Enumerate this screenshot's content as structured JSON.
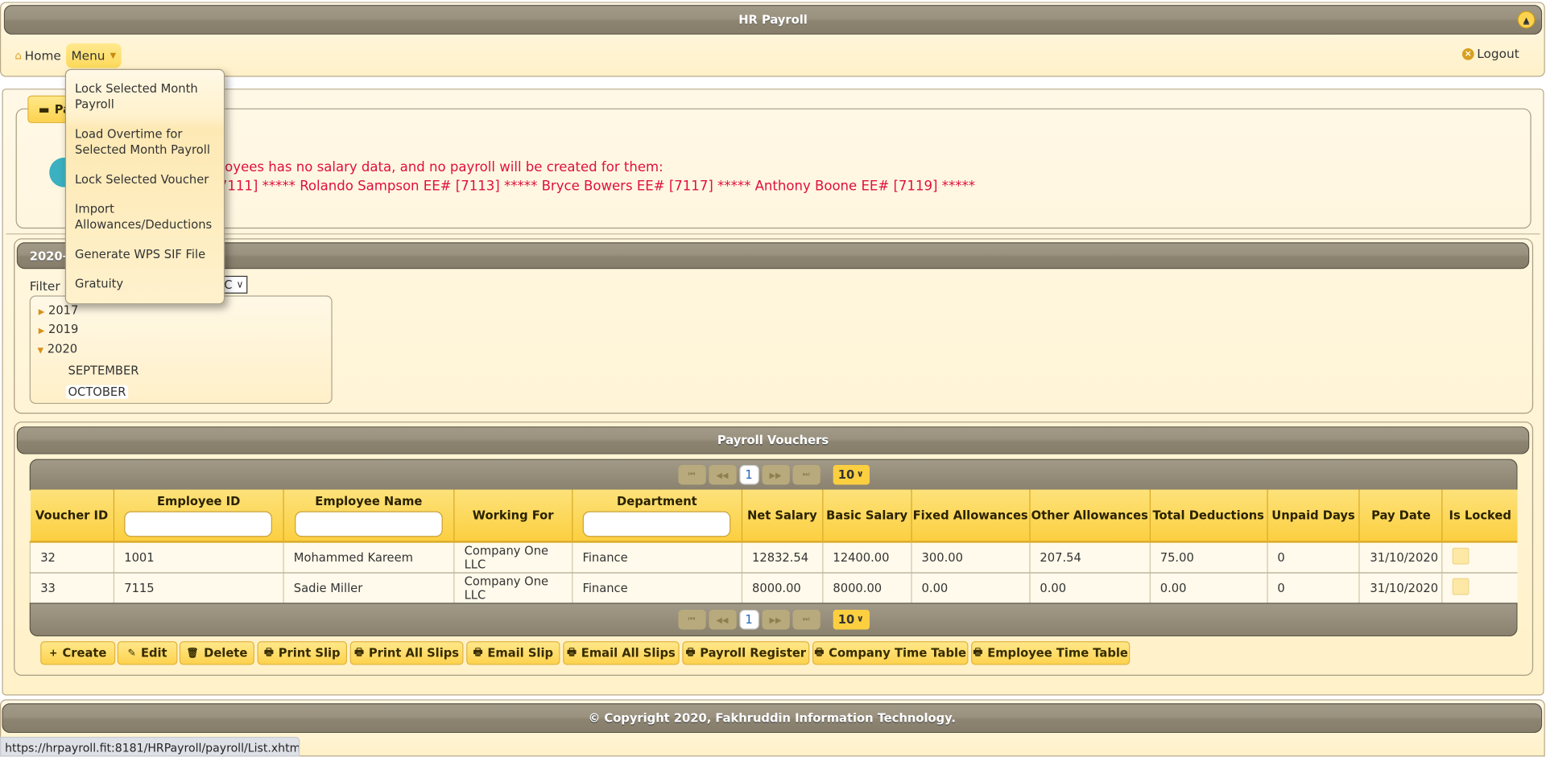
{
  "app": {
    "title": "HR Payroll"
  },
  "nav": {
    "home": "Home",
    "menu": "Menu",
    "logout": "Logout"
  },
  "menu_items": [
    "Lock Selected Month Payroll",
    "Load Overtime for Selected Month Payroll",
    "Lock Selected Voucher",
    "Import Allowances/Deductions",
    "Generate WPS SIF File",
    "Gratuity"
  ],
  "message_panel": {
    "legend": "Pa",
    "line1": "oyees has no salary data, and no payroll will be created for them:",
    "line2": "7111] ***** Rolando Sampson EE# [7113] ***** Bryce Bowers EE# [7117] ***** Anthony Boone EE# [7119] *****"
  },
  "period_panel": {
    "title": "2020-",
    "filter_label": "Filter B",
    "filter_value": "C",
    "tree": [
      {
        "label": "2017",
        "expanded": false
      },
      {
        "label": "2019",
        "expanded": false
      },
      {
        "label": "2020",
        "expanded": true,
        "children": [
          "SEPTEMBER",
          "OCTOBER"
        ]
      }
    ],
    "selected": "OCTOBER"
  },
  "vouchers": {
    "title": "Payroll Vouchers",
    "page": "1",
    "rows_per_page": "10",
    "columns": [
      "Voucher ID",
      "Employee ID",
      "Employee Name",
      "Working For",
      "Department",
      "Net Salary",
      "Basic Salary",
      "Fixed Allowances",
      "Other Allowances",
      "Total Deductions",
      "Unpaid Days",
      "Pay Date",
      "Is Locked"
    ],
    "rows": [
      [
        "32",
        "1001",
        "Mohammed Kareem",
        "Company One LLC",
        "Finance",
        "12832.54",
        "12400.00",
        "300.00",
        "207.54",
        "75.00",
        "0",
        "31/10/2020"
      ],
      [
        "33",
        "7115",
        "Sadie Miller",
        "Company One LLC",
        "Finance",
        "8000.00",
        "8000.00",
        "0.00",
        "0.00",
        "0.00",
        "0",
        "31/10/2020"
      ]
    ]
  },
  "buttons": [
    {
      "label": "Create",
      "icon": "plus-icon"
    },
    {
      "label": "Edit",
      "icon": "pencil-icon"
    },
    {
      "label": "Delete",
      "icon": "trash-icon"
    },
    {
      "label": "Print Slip",
      "icon": "print-icon"
    },
    {
      "label": "Print All Slips",
      "icon": "print-icon"
    },
    {
      "label": "Email Slip",
      "icon": "print-icon"
    },
    {
      "label": "Email All Slips",
      "icon": "print-icon"
    },
    {
      "label": "Payroll Register",
      "icon": "print-icon"
    },
    {
      "label": "Company Time Table",
      "icon": "print-icon"
    },
    {
      "label": "Employee Time Table",
      "icon": "print-icon"
    }
  ],
  "footer": {
    "copyright": "© Copyright 2020, Fakhruddin Information Technology."
  },
  "status_url": "https://hrpayroll.fit:8181/HRPayroll/payroll/List.xhtml#",
  "colors": {
    "accent": "#fccf40",
    "header_bar": "#9a917f",
    "error_text": "#e0103a",
    "background": "#fff3d0"
  }
}
